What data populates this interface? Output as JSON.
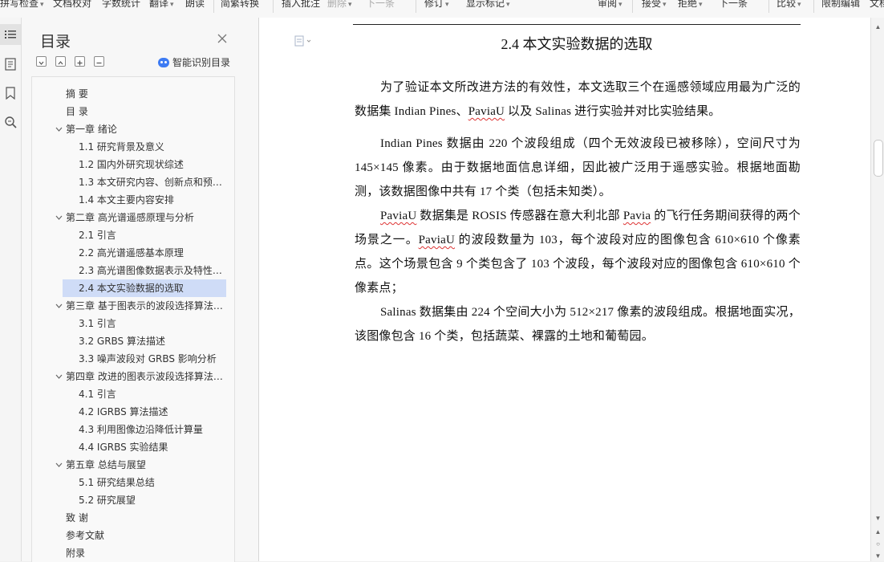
{
  "toolbar": {
    "items": [
      {
        "label": "拼写检查",
        "caret": true
      },
      {
        "label": "文档校对",
        "caret": false
      },
      {
        "label": "字数统计",
        "caret": false
      },
      {
        "label": "翻译",
        "caret": true
      },
      {
        "label": "朗读",
        "caret": false
      },
      {
        "label": "简繁转换",
        "caret": false
      },
      {
        "label": "插入批注",
        "caret": false
      },
      {
        "label": "删除",
        "caret": true
      },
      {
        "label": "下一条",
        "caret": false
      },
      {
        "label": "修订",
        "caret": true
      },
      {
        "label": "显示标记",
        "caret": true
      },
      {
        "label": "审阅",
        "caret": true
      },
      {
        "label": "接受",
        "caret": true
      },
      {
        "label": "拒绝",
        "caret": true
      },
      {
        "label": "下一条",
        "caret": false
      },
      {
        "label": "比较",
        "caret": true
      },
      {
        "label": "限制编辑",
        "caret": false
      },
      {
        "label": "文档",
        "caret": false
      }
    ]
  },
  "toc": {
    "title": "目录",
    "smart_label": "智能识别目录",
    "items": [
      {
        "level": 1,
        "text": "摘 要",
        "expandable": false
      },
      {
        "level": 1,
        "text": "目 录",
        "expandable": false
      },
      {
        "level": 1,
        "text": "第一章 绪论",
        "expandable": true
      },
      {
        "level": 2,
        "text": "1.1 研究背景及意义"
      },
      {
        "level": 2,
        "text": "1.2 国内外研究现状综述"
      },
      {
        "level": 2,
        "text": "1.3 本文研究内容、创新点和预期成果"
      },
      {
        "level": 2,
        "text": "1.4 本文主要内容安排"
      },
      {
        "level": 1,
        "text": "第二章 高光谱遥感原理与分析",
        "expandable": true
      },
      {
        "level": 2,
        "text": "2.1 引言"
      },
      {
        "level": 2,
        "text": "2.2 高光谱遥感基本原理"
      },
      {
        "level": 2,
        "text": "2.3 高光谱图像数据表示及特性分析"
      },
      {
        "level": 2,
        "text": "2.4 本文实验数据的选取",
        "selected": true
      },
      {
        "level": 1,
        "text": "第三章 基于图表示的波段选择算法研究",
        "expandable": true
      },
      {
        "level": 2,
        "text": "3.1 引言"
      },
      {
        "level": 2,
        "text": "3.2 GRBS 算法描述"
      },
      {
        "level": 2,
        "text": "3.3 噪声波段对 GRBS 影响分析"
      },
      {
        "level": 1,
        "text": "第四章 改进的图表示波段选择算法研究",
        "expandable": true
      },
      {
        "level": 2,
        "text": "4.1 引言"
      },
      {
        "level": 2,
        "text": "4.2 IGRBS 算法描述"
      },
      {
        "level": 2,
        "text": "4.3 利用图像边沿降低计算量"
      },
      {
        "level": 2,
        "text": "4.4 IGRBS 实验结果"
      },
      {
        "level": 1,
        "text": "第五章 总结与展望",
        "expandable": true
      },
      {
        "level": 2,
        "text": "5.1 研究结果总结"
      },
      {
        "level": 2,
        "text": "5.2 研究展望"
      },
      {
        "level": 1,
        "text": "致 谢",
        "expandable": false
      },
      {
        "level": 1,
        "text": "参考文献",
        "expandable": false
      },
      {
        "level": 1,
        "text": "附录",
        "expandable": false
      }
    ]
  },
  "document": {
    "heading": "2.4 本文实验数据的选取",
    "paragraphs": [
      "为了验证本文所改进方法的有效性，本文选取三个在遥感领域应用最为广泛的数据集 Indian Pines、PaviaU 以及 Salinas 进行实验并对比实验结果。",
      "Indian Pines 数据由 220 个波段组成（四个无效波段已被移除），空间尺寸为 145×145 像素。由于数据地面信息详细，因此被广泛用于遥感实验。根据地面勘测，该数据图像中共有 17 个类（包括未知类）。",
      "PaviaU 数据集是 ROSIS 传感器在意大利北部 Pavia 的飞行任务期间获得的两个场景之一。PaviaU 的波段数量为 103，每个波段对应的图像包含 610×610 个像素点。这个场景包含 9 个类包含了 103 个波段，每个波段对应的图像包含 610×610 个像素点；",
      "Salinas 数据集由 224 个空间大小为 512×217 像素的波段组成。根据地面实况，该图像包含 16 个类，包括蔬菜、裸露的土地和葡萄园。"
    ]
  },
  "colors": {
    "selection": "#cfdcf7",
    "accent": "#3d7bf3",
    "spellcheck": "#d33"
  }
}
